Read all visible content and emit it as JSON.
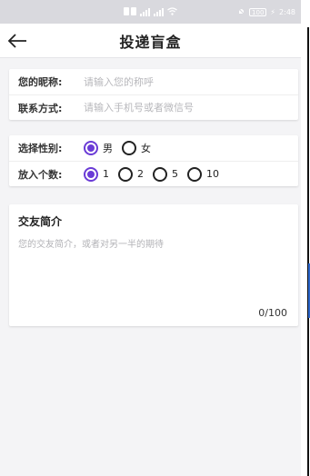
{
  "status_bar": {
    "time": "2:48",
    "battery": "100"
  },
  "header": {
    "title": "投递盲盒"
  },
  "contact": {
    "nickname_label": "您的昵称:",
    "nickname_placeholder": "请输入您的称呼",
    "contact_label": "联系方式:",
    "contact_placeholder": "请输入手机号或者微信号"
  },
  "options": {
    "gender_label": "选择性别:",
    "gender_options": [
      "男",
      "女"
    ],
    "gender_selected": "男",
    "count_label": "放入个数:",
    "count_options": [
      "1",
      "2",
      "5",
      "10"
    ],
    "count_selected": "1"
  },
  "intro": {
    "title": "交友简介",
    "placeholder": "您的交友简介，或者对另一半的期待",
    "counter": "0/100"
  },
  "colors": {
    "accent": "#6a3bd6",
    "background": "#f4f4f6"
  }
}
